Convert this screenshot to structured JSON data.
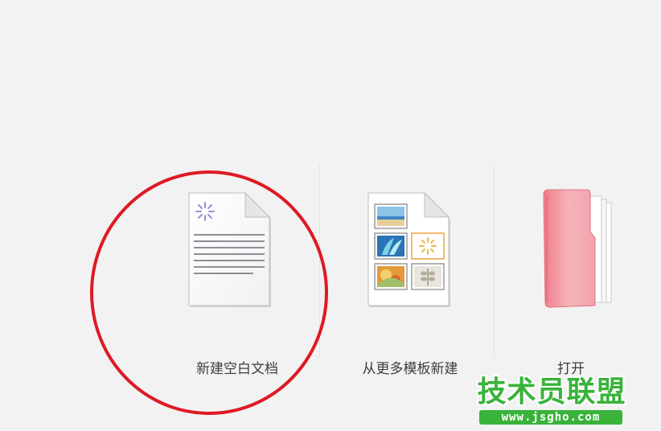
{
  "options": {
    "blank": {
      "label": "新建空白文档",
      "icon": "blank-document-icon"
    },
    "template": {
      "label": "从更多模板新建",
      "icon": "template-document-icon"
    },
    "open": {
      "label": "打开",
      "icon": "folder-icon"
    }
  },
  "watermark": {
    "title": "技术员联盟",
    "url": "www.jsgho.com"
  },
  "colors": {
    "background": "#f3f2f2",
    "highlight_ring": "#dd1a25",
    "watermark_green": "#39b33a",
    "folder_pink": "#f4a4ab"
  }
}
